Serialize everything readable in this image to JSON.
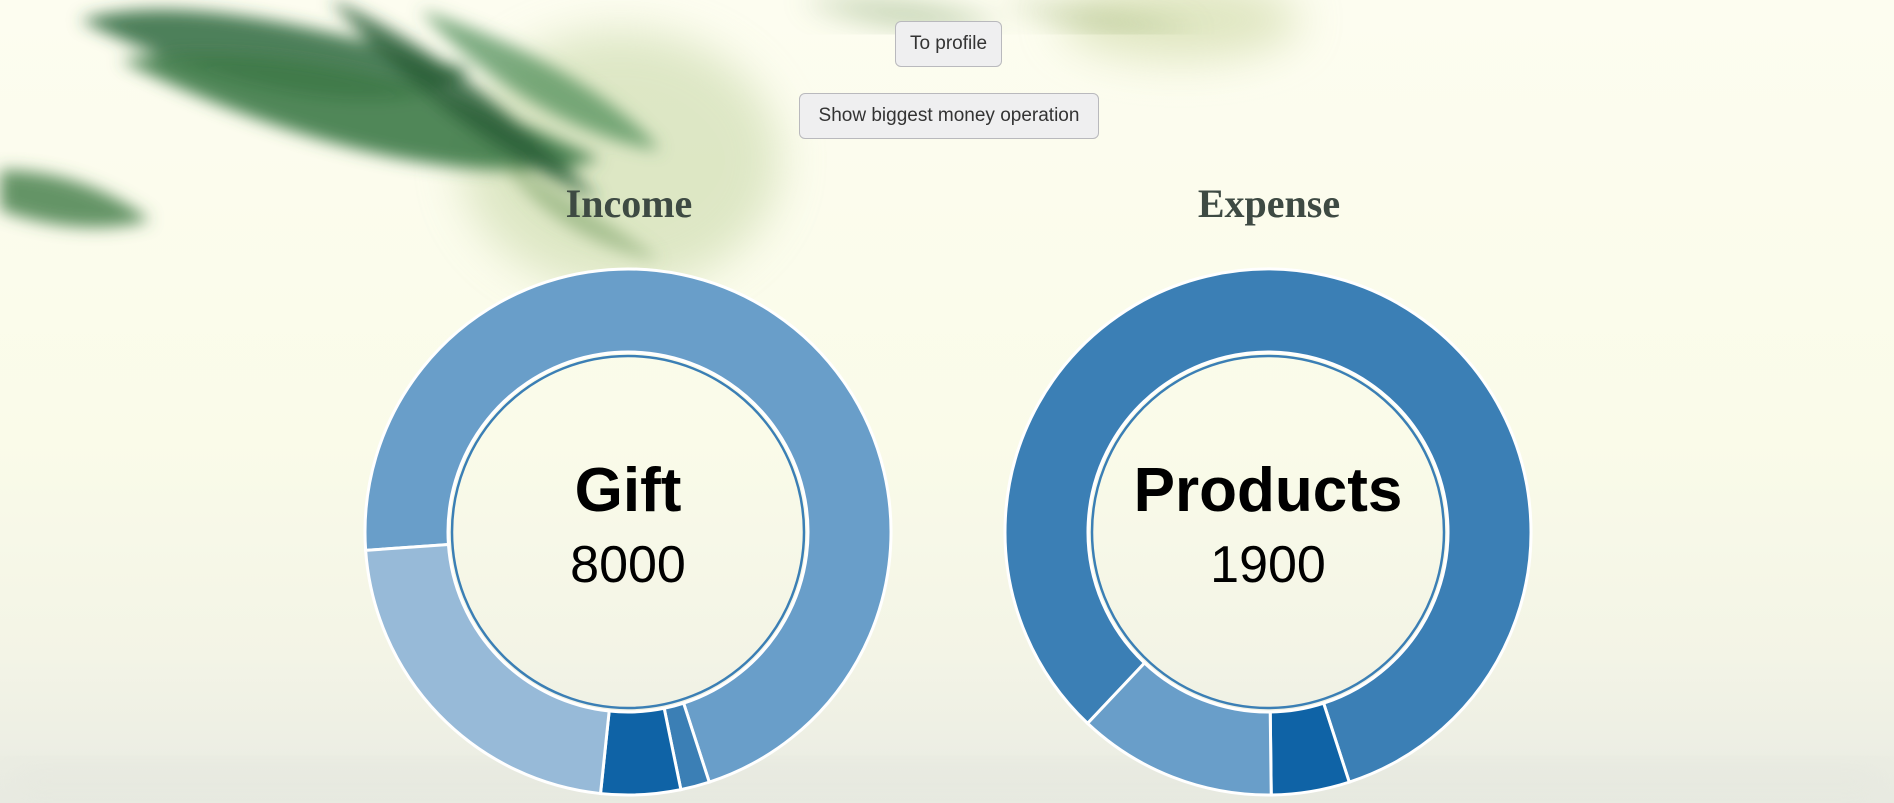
{
  "buttons": {
    "to_profile": "To profile",
    "show_biggest": "Show biggest money operation"
  },
  "colors": {
    "background": "#fafbe9",
    "title": "#3e4a43",
    "ring_stroke": "#ffffff",
    "blue_1": "#699ec9",
    "blue_2": "#97bad8",
    "blue_3": "#0f63a6",
    "blue_4": "#3b7fb5"
  },
  "chart_data": [
    {
      "type": "pie",
      "title": "Income",
      "center_label": "Gift",
      "center_value": "8000",
      "slices": [
        {
          "value": 8000,
          "color": "#699ec9"
        },
        {
          "value": 200,
          "color": "#3b7fb5"
        },
        {
          "value": 550,
          "color": "#0f63a6"
        },
        {
          "value": 2500,
          "color": "#97bad8"
        }
      ]
    },
    {
      "type": "pie",
      "title": "Expense",
      "center_label": "Products",
      "center_value": "1900",
      "slices": [
        {
          "value": 1900,
          "color": "#3b7fb5"
        },
        {
          "value": 110,
          "color": "#0f63a6"
        },
        {
          "value": 280,
          "color": "#699ec9"
        }
      ]
    }
  ]
}
